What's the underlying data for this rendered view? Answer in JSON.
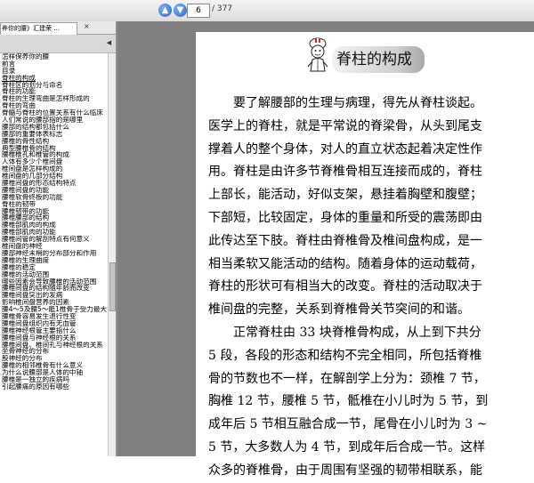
{
  "toolbar": {
    "current_page": "6",
    "total_pages": "/ 377",
    "up_icon": "arrow-up-icon",
    "down_icon": "arrow-down-icon"
  },
  "tab": {
    "label": "养你的腰》汇建荣 ...",
    "close": "×"
  },
  "panel": {
    "collapse_glyph": "◀"
  },
  "outline": {
    "items": [
      "怎样保养你的腰",
      "前言",
      "目录",
      "脊柱的构成",
      "脊柱区的划分与命名",
      "脊柱的功能",
      "脊柱的生理弯曲是怎样形成的",
      "脊柱的弯曲",
      "脊髓与脊柱的位置关系有什么临床",
      "人们常说的腰部指的是哪里",
      "腰部的结构都包括什么",
      "腰部的重要体表标志",
      "腰椎的骨性结构",
      "典型腰椎骨的结构",
      "腰椎椎孔和椎管的构成",
      "人体有多少个椎间盘",
      "椎间盘是怎样构成的",
      "椎间盘的几部分结构",
      "腰椎间盘的形态结构特点",
      "腰椎间盘的功能",
      "腰椎软骨终板的功能",
      "脊柱的韧带",
      "腰椎韧带的功能",
      "腰椎腰部的结构",
      "腰椎部肌肉的构成",
      "腰椎部肌肉的功能",
      "腰椎间管的解剖特点有何意义",
      "椎间盘的神经",
      "腰部神经末梢的分布部分和作用",
      "腰椎的生理曲度",
      "腰椎的稳定",
      "腰椎的活动范围",
      "哪些因素会导致腰椎的活动范围",
      "腰椎间盘的结构随年龄而改变",
      "腰椎间盘突出的发病",
      "影响椎间盘营养的因素",
      "腰4～5及腰5～骶1椎骨于受力最大",
      "腰椎骨容易发生退行性变",
      "腰椎间盘组织内有无血管",
      "腰椎神经根管主要指什么",
      "腰椎间盘与神经根的关系",
      "腰椎间盘、椎间孔与神经根的关系",
      "坐骨神经的分布",
      "股神经的分布",
      "腰椎的相邻椎骨有什么意义",
      "为什么说腰部是人体的中轴",
      "腰椎是一独立的疾病吗",
      "引起腰痛的原因有哪些"
    ]
  },
  "document": {
    "figure_icon": "doctor-figure-icon",
    "title": "脊柱的构成",
    "lines": [
      "　　要了解腰部的生理与病理，得先从脊柱谈起。",
      "医学上的脊柱，就是平常说的脊梁骨，从头到尾支",
      "撑着人的整个身体，对人的直立状态起着决定性作",
      "用。脊柱是由许多节脊椎骨相互连接而成的，脊柱",
      "上部长，能活动，好似支架，悬挂着胸壁和腹壁；",
      "下部短，比较固定，身体的重量和所受的震荡即由",
      "此传达至下肢。脊柱由脊椎骨及椎间盘构成，是一",
      "相当柔软又能活动的结构。随着身体的运动载荷，",
      "脊柱的形状可有相当大的改变。脊柱的活动取决于",
      "椎间盘的完整，关系到脊椎骨关节突间的和谐。",
      "　　正常脊柱由 33 块脊椎骨构成，从上到下共分",
      "5 段，各段的形态和结构不完全相同，所包括脊椎",
      "骨的节数也不一样，在解剖学上分为：颈椎 7 节，",
      "胸椎 12 节，腰椎 5 节，骶椎在小儿时为 5 节，到",
      "成年后 5 节相互融合成一节，尾骨在小儿时为 3 ~",
      "5 节，大多数人为 4 节，到成年后合成一节。这样",
      "众多的脊椎骨，由于周围有坚强的韧带相联系，能"
    ]
  }
}
